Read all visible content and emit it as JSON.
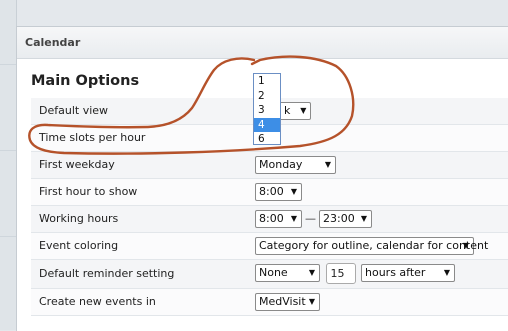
{
  "panel": {
    "title": "Calendar"
  },
  "section": {
    "title": "Main Options"
  },
  "rows": [
    {
      "label": "Default view",
      "value": "k"
    },
    {
      "label": "Time slots per hour"
    },
    {
      "label": "First weekday",
      "value": "Monday"
    },
    {
      "label": "First hour to show",
      "value": "8:00"
    },
    {
      "label": "Working hours",
      "from": "8:00",
      "separator": "—",
      "to": "23:00"
    },
    {
      "label": "Event coloring",
      "value": "Category for outline, calendar for content"
    },
    {
      "label": "Default reminder setting",
      "type": "None",
      "amount": "15",
      "unit": "hours after"
    },
    {
      "label": "Create new events in",
      "value": "MedVisit"
    }
  ],
  "timeslots_dropdown": {
    "options": [
      "1",
      "2",
      "3",
      "4",
      "6"
    ],
    "selected": "4"
  },
  "annotation": {
    "color": "#b5522a"
  },
  "icons": {
    "dropdown": "▼"
  }
}
